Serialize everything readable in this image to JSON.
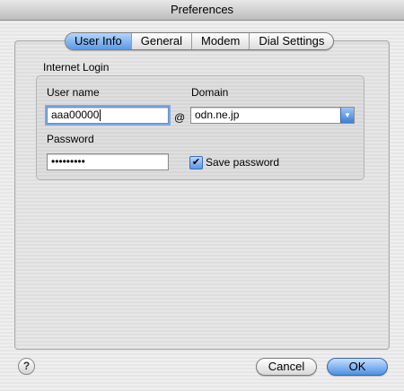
{
  "window": {
    "title": "Preferences"
  },
  "tabs": [
    {
      "label": "User Info",
      "selected": true
    },
    {
      "label": "General",
      "selected": false
    },
    {
      "label": "Modem",
      "selected": false
    },
    {
      "label": "Dial Settings",
      "selected": false
    }
  ],
  "login": {
    "group_label": "Internet Login",
    "username_label": "User name",
    "username_value": "aaa00000",
    "at_symbol": "@",
    "domain_label": "Domain",
    "domain_value": "odn.ne.jp",
    "password_label": "Password",
    "password_value": "•••••••••",
    "save_password_label": "Save password",
    "save_password_checked": true
  },
  "buttons": {
    "help": "?",
    "cancel": "Cancel",
    "ok": "OK"
  },
  "colors": {
    "accent": "#5b9ae6"
  }
}
